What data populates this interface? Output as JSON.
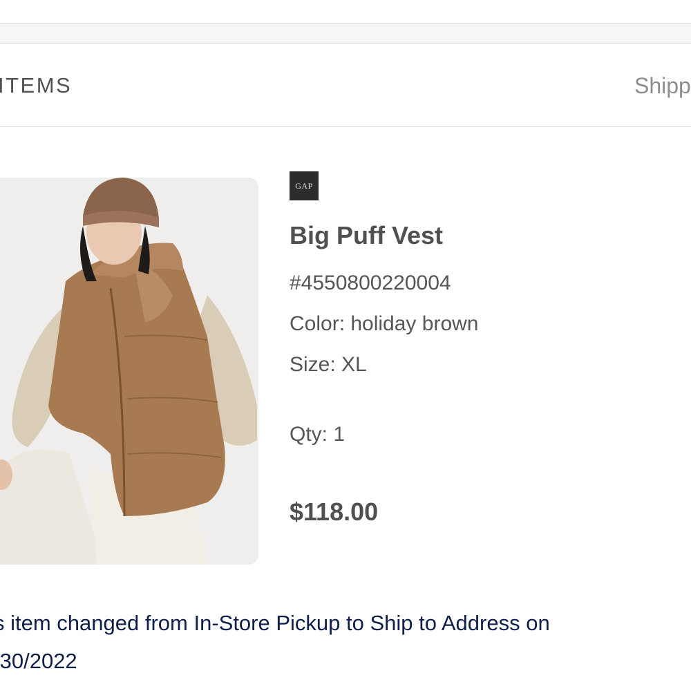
{
  "items_section": {
    "title": "ITEMS",
    "shipping_label": "Shipp"
  },
  "product": {
    "image_icon": "product-photo-puffer-vest",
    "brand": "GAP",
    "name": "Big Puff Vest",
    "sku": "#4550800220004",
    "color": "Color: holiday brown",
    "size": "Size: XL",
    "qty": "Qty: 1",
    "price": "$118.00"
  },
  "notice": {
    "line1": "s item changed from In-Store Pickup to Ship to Address on",
    "line2": "/30/2022"
  },
  "colors": {
    "divider": "#d6d6d6",
    "text": "#555555",
    "notice_text": "#0f1f4a",
    "logo_bg": "#2c2c2c"
  }
}
